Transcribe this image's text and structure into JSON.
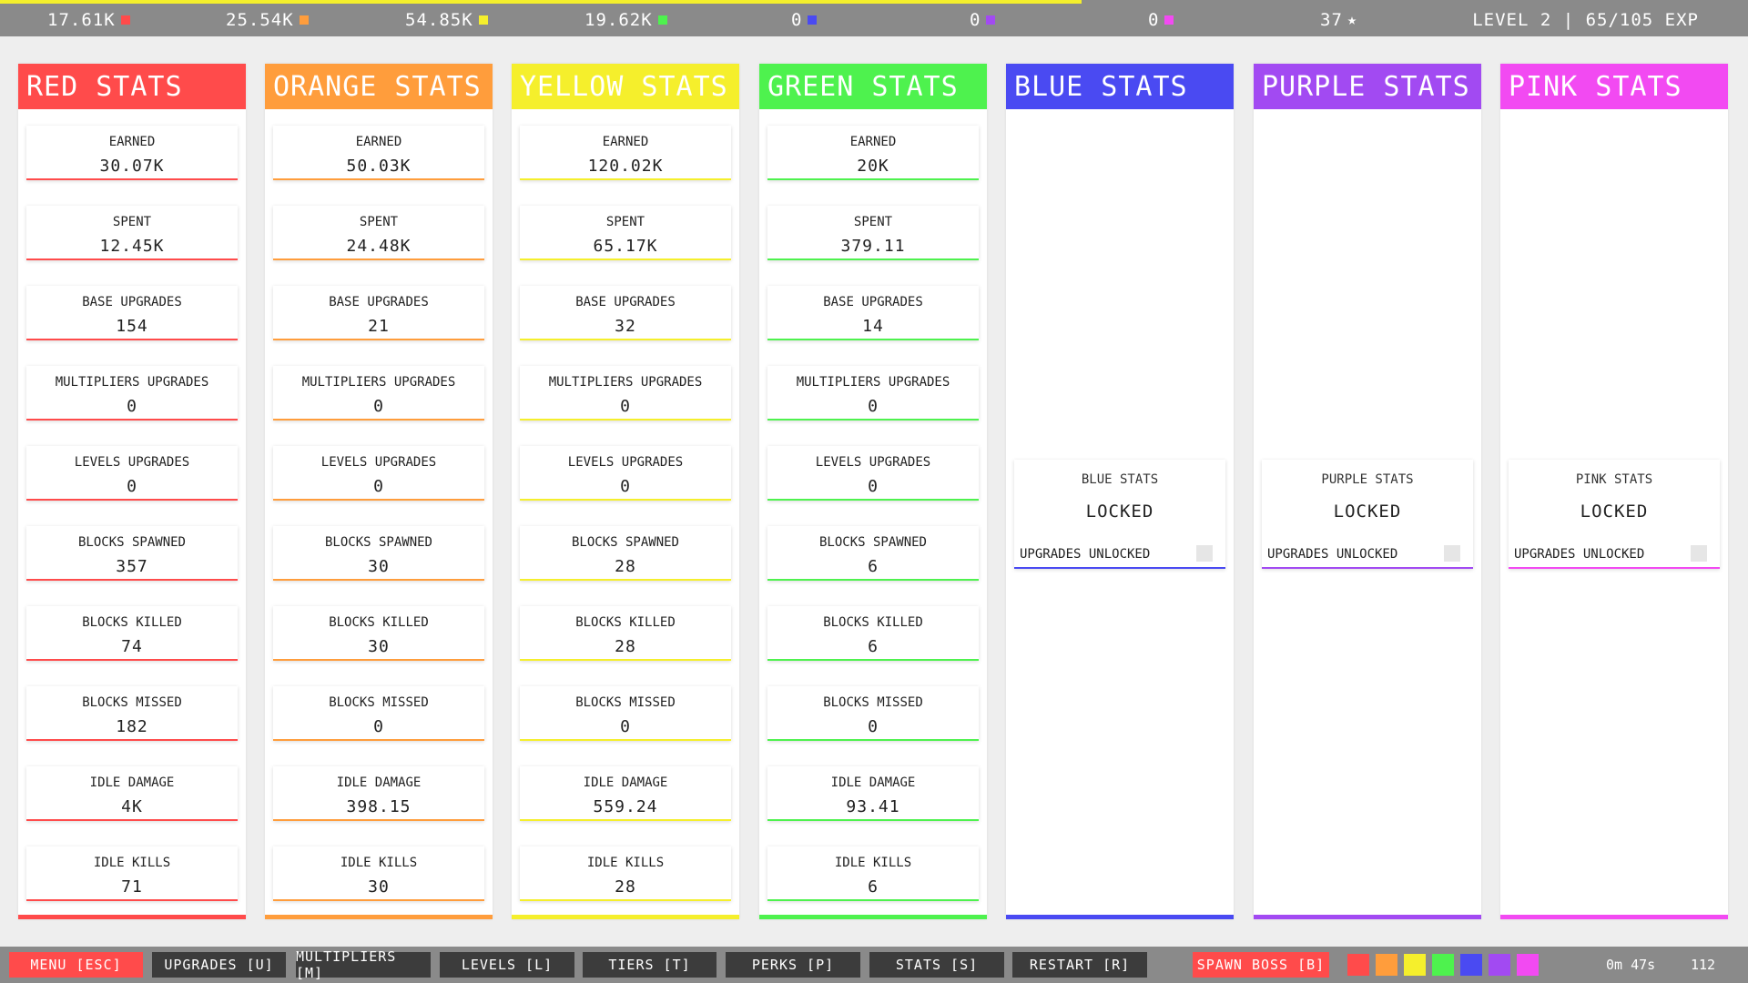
{
  "topbar": {
    "xp_fraction": 0.619,
    "resources": [
      {
        "value": "17.61K",
        "color": "#ff4b4b"
      },
      {
        "value": "25.54K",
        "color": "#ff9d3c"
      },
      {
        "value": "54.85K",
        "color": "#f5ef2c"
      },
      {
        "value": "19.62K",
        "color": "#4ef24e"
      },
      {
        "value": "0",
        "color": "#4a4af2"
      },
      {
        "value": "0",
        "color": "#a24af2"
      },
      {
        "value": "0",
        "color": "#f24af2"
      }
    ],
    "stars": "37",
    "level_text": "LEVEL 2 | 65/105 EXP"
  },
  "columns": [
    {
      "title": "RED STATS",
      "color": "#ff4b4b",
      "locked": false,
      "stats": [
        {
          "label": "EARNED",
          "value": "30.07K"
        },
        {
          "label": "SPENT",
          "value": "12.45K"
        },
        {
          "label": "BASE UPGRADES",
          "value": "154"
        },
        {
          "label": "MULTIPLIERS UPGRADES",
          "value": "0"
        },
        {
          "label": "LEVELS UPGRADES",
          "value": "0"
        },
        {
          "label": "BLOCKS SPAWNED",
          "value": "357"
        },
        {
          "label": "BLOCKS KILLED",
          "value": "74"
        },
        {
          "label": "BLOCKS MISSED",
          "value": "182"
        },
        {
          "label": "IDLE DAMAGE",
          "value": "4K"
        },
        {
          "label": "IDLE KILLS",
          "value": "71"
        }
      ]
    },
    {
      "title": "ORANGE STATS",
      "color": "#ff9d3c",
      "locked": false,
      "stats": [
        {
          "label": "EARNED",
          "value": "50.03K"
        },
        {
          "label": "SPENT",
          "value": "24.48K"
        },
        {
          "label": "BASE UPGRADES",
          "value": "21"
        },
        {
          "label": "MULTIPLIERS UPGRADES",
          "value": "0"
        },
        {
          "label": "LEVELS UPGRADES",
          "value": "0"
        },
        {
          "label": "BLOCKS SPAWNED",
          "value": "30"
        },
        {
          "label": "BLOCKS KILLED",
          "value": "30"
        },
        {
          "label": "BLOCKS MISSED",
          "value": "0"
        },
        {
          "label": "IDLE DAMAGE",
          "value": "398.15"
        },
        {
          "label": "IDLE KILLS",
          "value": "30"
        }
      ]
    },
    {
      "title": "YELLOW STATS",
      "color": "#f5ef2c",
      "locked": false,
      "stats": [
        {
          "label": "EARNED",
          "value": "120.02K"
        },
        {
          "label": "SPENT",
          "value": "65.17K"
        },
        {
          "label": "BASE UPGRADES",
          "value": "32"
        },
        {
          "label": "MULTIPLIERS UPGRADES",
          "value": "0"
        },
        {
          "label": "LEVELS UPGRADES",
          "value": "0"
        },
        {
          "label": "BLOCKS SPAWNED",
          "value": "28"
        },
        {
          "label": "BLOCKS KILLED",
          "value": "28"
        },
        {
          "label": "BLOCKS MISSED",
          "value": "0"
        },
        {
          "label": "IDLE DAMAGE",
          "value": "559.24"
        },
        {
          "label": "IDLE KILLS",
          "value": "28"
        }
      ]
    },
    {
      "title": "GREEN STATS",
      "color": "#4ef24e",
      "locked": false,
      "stats": [
        {
          "label": "EARNED",
          "value": "20K"
        },
        {
          "label": "SPENT",
          "value": "379.11"
        },
        {
          "label": "BASE UPGRADES",
          "value": "14"
        },
        {
          "label": "MULTIPLIERS UPGRADES",
          "value": "0"
        },
        {
          "label": "LEVELS UPGRADES",
          "value": "0"
        },
        {
          "label": "BLOCKS SPAWNED",
          "value": "6"
        },
        {
          "label": "BLOCKS KILLED",
          "value": "6"
        },
        {
          "label": "BLOCKS MISSED",
          "value": "0"
        },
        {
          "label": "IDLE DAMAGE",
          "value": "93.41"
        },
        {
          "label": "IDLE KILLS",
          "value": "6"
        }
      ]
    },
    {
      "title": "BLUE STATS",
      "color": "#4a4af2",
      "locked": true,
      "lock_title": "BLUE STATS",
      "lock_value": "LOCKED",
      "lock_unlocked_label": "UPGRADES UNLOCKED"
    },
    {
      "title": "PURPLE STATS",
      "color": "#a24af2",
      "locked": true,
      "lock_title": "PURPLE STATS",
      "lock_value": "LOCKED",
      "lock_unlocked_label": "UPGRADES UNLOCKED"
    },
    {
      "title": "PINK STATS",
      "color": "#f24af2",
      "locked": true,
      "lock_title": "PINK STATS",
      "lock_value": "LOCKED",
      "lock_unlocked_label": "UPGRADES UNLOCKED"
    }
  ],
  "bottombar": {
    "buttons": [
      {
        "label": "MENU [ESC]",
        "style": "red"
      },
      {
        "label": "UPGRADES [U]",
        "style": "dark"
      },
      {
        "label": "MULTIPLIERS [M]",
        "style": "dark"
      },
      {
        "label": "LEVELS [L]",
        "style": "dark"
      },
      {
        "label": "TIERS [T]",
        "style": "dark"
      },
      {
        "label": "PERKS [P]",
        "style": "dark"
      },
      {
        "label": "STATS [S]",
        "style": "dark"
      },
      {
        "label": "RESTART [R]",
        "style": "dark"
      }
    ],
    "spawn_boss": "SPAWN BOSS [B]",
    "color_buttons": [
      "#ff4b4b",
      "#ff9d3c",
      "#f5ef2c",
      "#4ef24e",
      "#4a4af2",
      "#a24af2",
      "#f24af2"
    ],
    "timer": "0m 47s",
    "count": "112"
  }
}
